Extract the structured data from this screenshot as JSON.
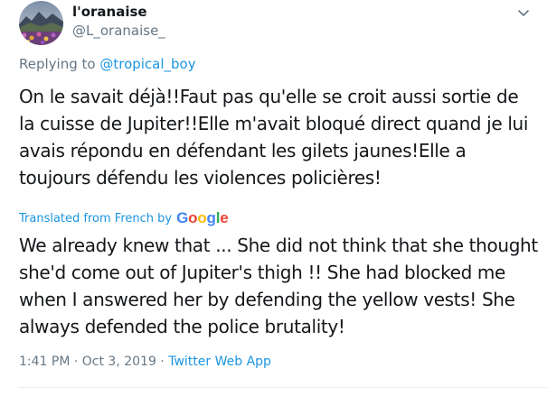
{
  "user": {
    "display_name": "l'oranaise",
    "handle": "@L_oranaise_"
  },
  "reply": {
    "prefix": "Replying to ",
    "mention": "@tropical_boy"
  },
  "tweet": {
    "text": "On le savait déjà!!Faut pas qu'elle se croit aussi sortie de la cuisse de Jupiter!!Elle m'avait bloqué direct quand je lui avais répondu en défendant les gilets jaunes!Elle a toujours défendu les violences policières!"
  },
  "translation": {
    "label": "Translated from French by",
    "provider": "Google",
    "text": "We already knew that ... She did not think that she thought she'd come out of Jupiter's thigh !! She had blocked me when I answered her by defending the yellow vests! She always defended the police brutality!"
  },
  "meta": {
    "timestamp": "1:41 PM · Oct 3, 2019",
    "separator": " · ",
    "source_app": "Twitter Web App"
  },
  "icons": {
    "avatar": "landscape-avatar",
    "menu": "chevron-down-icon"
  },
  "colors": {
    "link": "#1b95e0",
    "secondary_text": "#657786",
    "primary_text": "#14171a",
    "google_blue": "#4285f4",
    "google_red": "#ea4335",
    "google_yellow": "#fbbc05",
    "google_green": "#34a853"
  }
}
